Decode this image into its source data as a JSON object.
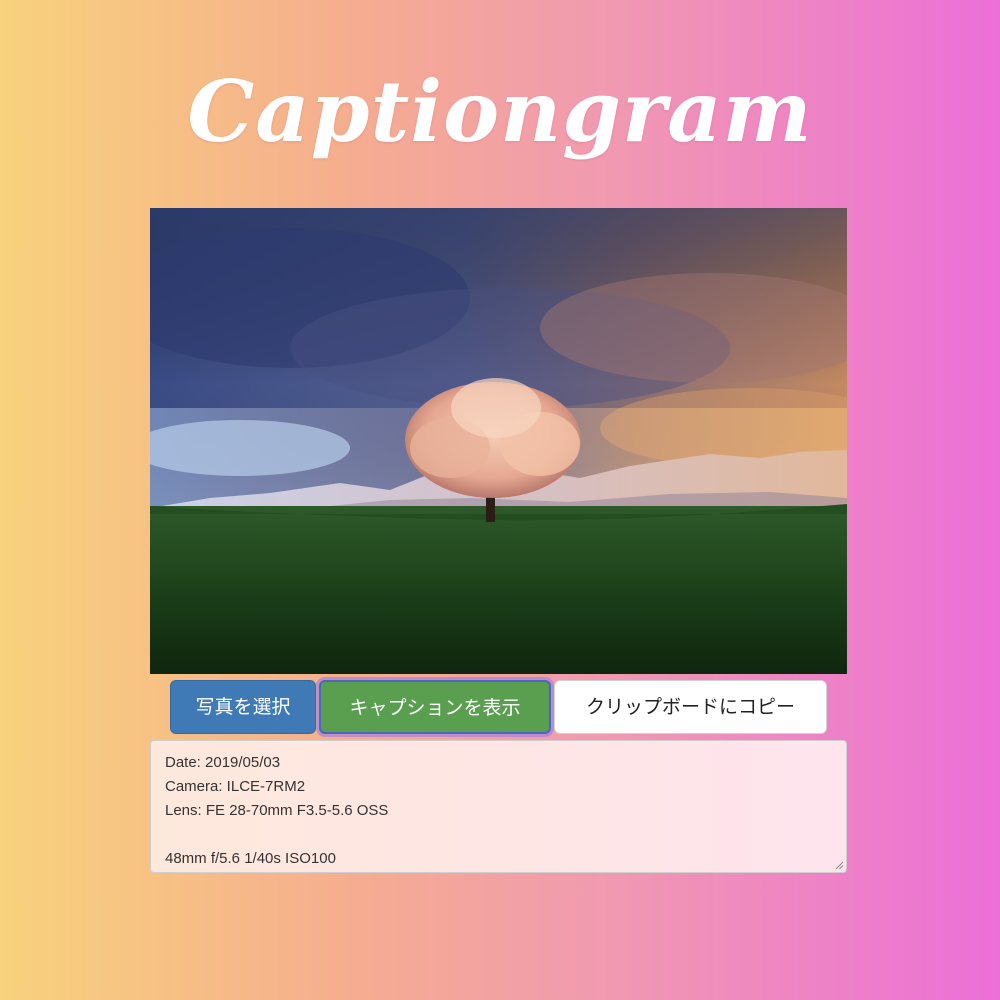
{
  "app": {
    "title": "Captiongram"
  },
  "photo": {
    "subject": "cherry-tree-in-field-at-sunset"
  },
  "buttons": {
    "select_photo": "写真を選択",
    "show_caption": "キャプションを表示",
    "copy_clipboard": "クリップボードにコピー"
  },
  "caption": {
    "lines": [
      "Date: 2019/05/03",
      "Camera: ILCE-7RM2",
      "Lens: FE 28-70mm F3.5-5.6 OSS",
      "",
      "48mm f/5.6 1/40s ISO100"
    ]
  },
  "colors": {
    "background_start": "#f8d27c",
    "background_end": "#ec6fd8",
    "select_button": "#3f7ab7",
    "show_button": "#5a9e50",
    "copy_button": "#ffffff"
  }
}
